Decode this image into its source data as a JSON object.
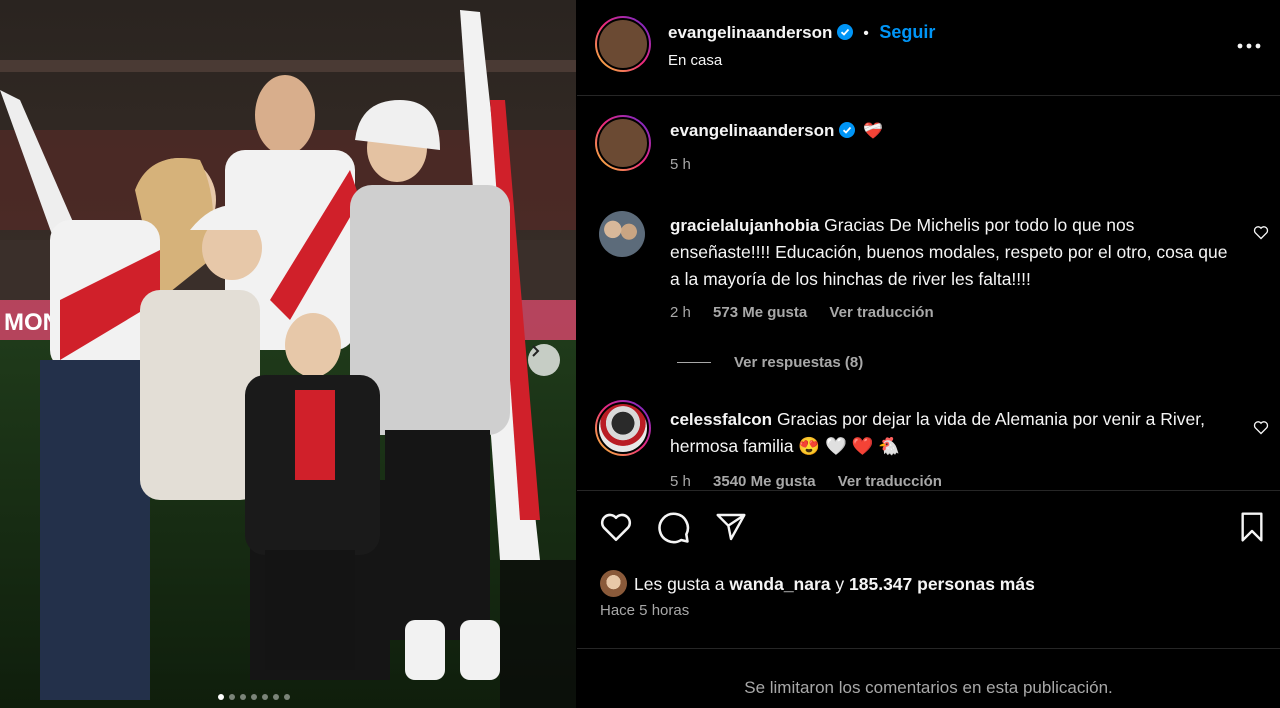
{
  "post": {
    "author": "evangelinaanderson",
    "follow_label": "Seguir",
    "separator": "•",
    "location": "En casa",
    "more_icon": "more-horizontal-icon"
  },
  "caption": {
    "author": "evangelinaanderson",
    "emoji": "❤️‍🩹",
    "time": "5 h"
  },
  "comments": [
    {
      "author": "gracielalujanhobia",
      "text": "Gracias De Michelis por todo lo que nos enseñaste!!!! Educación, buenos modales, respeto por el otro, cosa que a la mayoría de los hinchas de river les falta!!!!",
      "time": "2 h",
      "likes": "573 Me gusta",
      "translate": "Ver traducción",
      "replies": "Ver respuestas (8)"
    },
    {
      "author": "celessfalcon",
      "text": "Gracias por dejar la vida de Alemania por venir a River, hermosa familia 😍 🤍 ❤️ 🐔",
      "time": "5 h",
      "likes": "3540 Me gusta",
      "translate": "Ver traducción"
    }
  ],
  "likes_summary": {
    "prefix": "Les gusta a",
    "user": "wanda_nara",
    "connector": "y",
    "count": "185.347 personas más"
  },
  "posted_ago": "Hace 5 horas",
  "comments_restricted": "Se limitaron los comentarios en esta publicación.",
  "carousel": {
    "total": 7,
    "active": 1
  },
  "colors": {
    "accent": "#0095f6",
    "background": "#000000",
    "muted": "#a8a8a8",
    "heart": "#ed4956"
  }
}
